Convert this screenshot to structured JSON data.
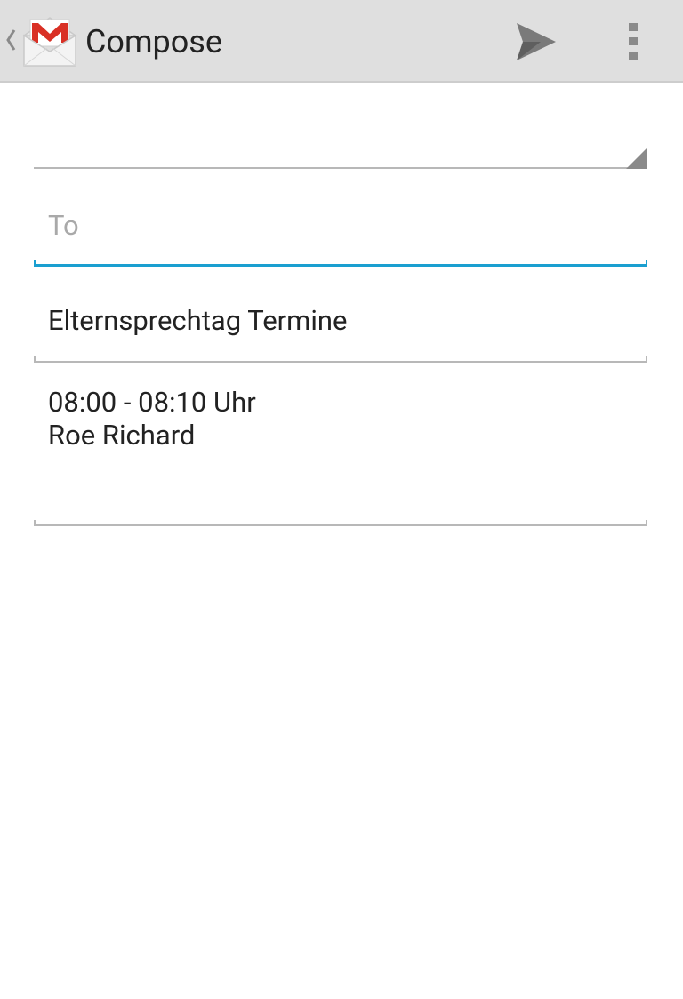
{
  "action_bar": {
    "title": "Compose",
    "app_icon": "gmail-icon",
    "up_icon": "up-caret-icon",
    "send_icon": "send-icon",
    "overflow_icon": "overflow-menu-icon",
    "background": "#dfdfdf"
  },
  "compose": {
    "from": {
      "value": ""
    },
    "to": {
      "value": "",
      "placeholder": "To"
    },
    "subject": {
      "value": "Elternsprechtag Termine"
    },
    "body": {
      "lines": [
        "08:00 - 08:10 Uhr",
        "Roe Richard"
      ]
    }
  },
  "colors": {
    "focus_accent": "#1a9fd0",
    "gmail_red": "#d93025",
    "divider": "#b8b8b8",
    "text": "#222222",
    "hint": "#a9a9a9"
  }
}
